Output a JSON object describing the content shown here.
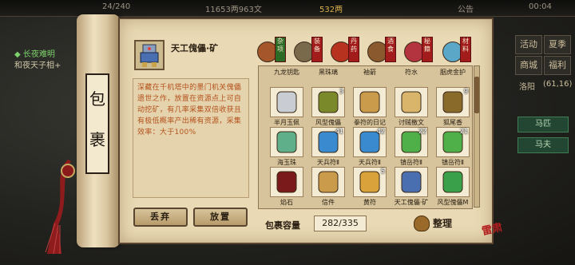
{
  "topbar": {
    "stamina": "24/240",
    "silver": "11653两963文",
    "gold": "532两",
    "notice": "公告",
    "time": "00:04"
  },
  "quest": {
    "title": "◆ 长夜难明",
    "line": "和夜天子相+"
  },
  "side": {
    "buttons": [
      "活动",
      "夏季",
      "商城",
      "福利"
    ],
    "map_label": "洛阳",
    "coords": "(61,16)",
    "horse1": "马匹",
    "horse2": "马夫"
  },
  "scroll_label": "包裹",
  "item": {
    "name": "天工傀儡·矿",
    "description": "深藏在千机塔中的墨门机关傀儡遗世之作，放置在资源点上可自动挖矿，有几率采集双倍收获且有极低概率产出稀有资源，采集效率：大于100%"
  },
  "actions": {
    "discard": "丢弃",
    "place": "放置"
  },
  "tabs": [
    {
      "label": "杂项",
      "color": "#a5572b",
      "active": true
    },
    {
      "label": "装备",
      "color": "#7a6a4c",
      "active": false
    },
    {
      "label": "丹药",
      "color": "#b8331f",
      "active": false
    },
    {
      "label": "酒食",
      "color": "#8a5a2e",
      "active": false
    },
    {
      "label": "秘籍",
      "color": "#b3343e",
      "active": false
    },
    {
      "label": "材料",
      "color": "#5aa7c8",
      "active": false
    }
  ],
  "inventory": {
    "top_row": [
      "九龙钥匙",
      "黑珠璃",
      "袖箭",
      "符水",
      "胭虎金护"
    ],
    "rows": [
      [
        {
          "name": "半月玉佩",
          "icon": "jade-pendant-icon",
          "count": "",
          "color": "#c9ccd2"
        },
        {
          "name": "风型傀儡",
          "icon": "puppet-wind-icon",
          "count": "3",
          "color": "#7a8a2a"
        },
        {
          "name": "拳符的日记",
          "icon": "diary-icon",
          "count": "",
          "color": "#c99b4a"
        },
        {
          "name": "讨贼檄文",
          "icon": "proclamation-icon",
          "count": "",
          "color": "#d8b56a"
        },
        {
          "name": "狐尾香",
          "icon": "incense-icon",
          "count": "9",
          "color": "#8a6a2a"
        }
      ],
      [
        {
          "name": "海玉珠",
          "icon": "pearl-icon",
          "count": "",
          "color": "#5fb08a"
        },
        {
          "name": "天兵符Ⅱ",
          "icon": "talisman-blue-icon",
          "count": "41",
          "color": "#3a8ad0"
        },
        {
          "name": "天兵符Ⅱ",
          "icon": "talisman-blue-icon",
          "count": "42",
          "color": "#3a8ad0"
        },
        {
          "name": "镇岳符Ⅱ",
          "icon": "talisman-green-icon",
          "count": "22",
          "color": "#4fb04a"
        },
        {
          "name": "镇岳符Ⅱ",
          "icon": "talisman-green-icon",
          "count": "21",
          "color": "#4fb04a"
        }
      ],
      [
        {
          "name": "焰石",
          "icon": "ember-stone-icon",
          "count": "",
          "color": "#7a1a1a"
        },
        {
          "name": "信件",
          "icon": "letter-icon",
          "count": "",
          "color": "#c99b4a"
        },
        {
          "name": "黄符",
          "icon": "yellow-talisman-icon",
          "count": "5",
          "color": "#d9a23a"
        },
        {
          "name": "天工傀儡·矿",
          "icon": "puppet-mine-icon",
          "count": "",
          "color": "#4a6fb0"
        },
        {
          "name": "风型傀儡M",
          "icon": "puppet-m-icon",
          "count": "",
          "color": "#3aa04a"
        }
      ]
    ],
    "capacity_label": "包裹容量",
    "capacity": "282/335",
    "sort": "整理"
  },
  "seal_text": "雷肃"
}
